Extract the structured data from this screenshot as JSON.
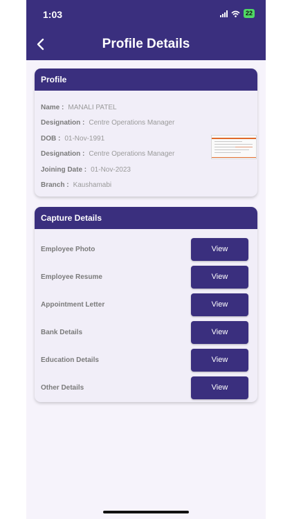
{
  "status_bar": {
    "time": "1:03",
    "battery": "22"
  },
  "header": {
    "title": "Profile Details",
    "back_icon": "chevron-left-icon"
  },
  "profile": {
    "section_title": "Profile",
    "rows": [
      {
        "label": "Name :",
        "value": "MANALI PATEL"
      },
      {
        "label": "Designation :",
        "value": "Centre Operations Manager"
      },
      {
        "label": "DOB :",
        "value": "01-Nov-1991"
      },
      {
        "label": "Designation :",
        "value": "Centre Operations Manager"
      },
      {
        "label": "Joining Date :",
        "value": "01-Nov-2023"
      },
      {
        "label": "Branch :",
        "value": "Kaushamabi"
      }
    ]
  },
  "capture": {
    "section_title": "Capture Details",
    "items": [
      {
        "label": "Employee Photo",
        "button": "View"
      },
      {
        "label": "Employee Resume",
        "button": "View"
      },
      {
        "label": "Appointment Letter",
        "button": "View"
      },
      {
        "label": "Bank Details",
        "button": "View"
      },
      {
        "label": "Education Details",
        "button": "View"
      },
      {
        "label": "Other Details",
        "button": "View"
      }
    ]
  },
  "colors": {
    "primary": "#3a2f7e",
    "card_bg": "#f1eef8",
    "page_bg": "#f6f3fb"
  }
}
